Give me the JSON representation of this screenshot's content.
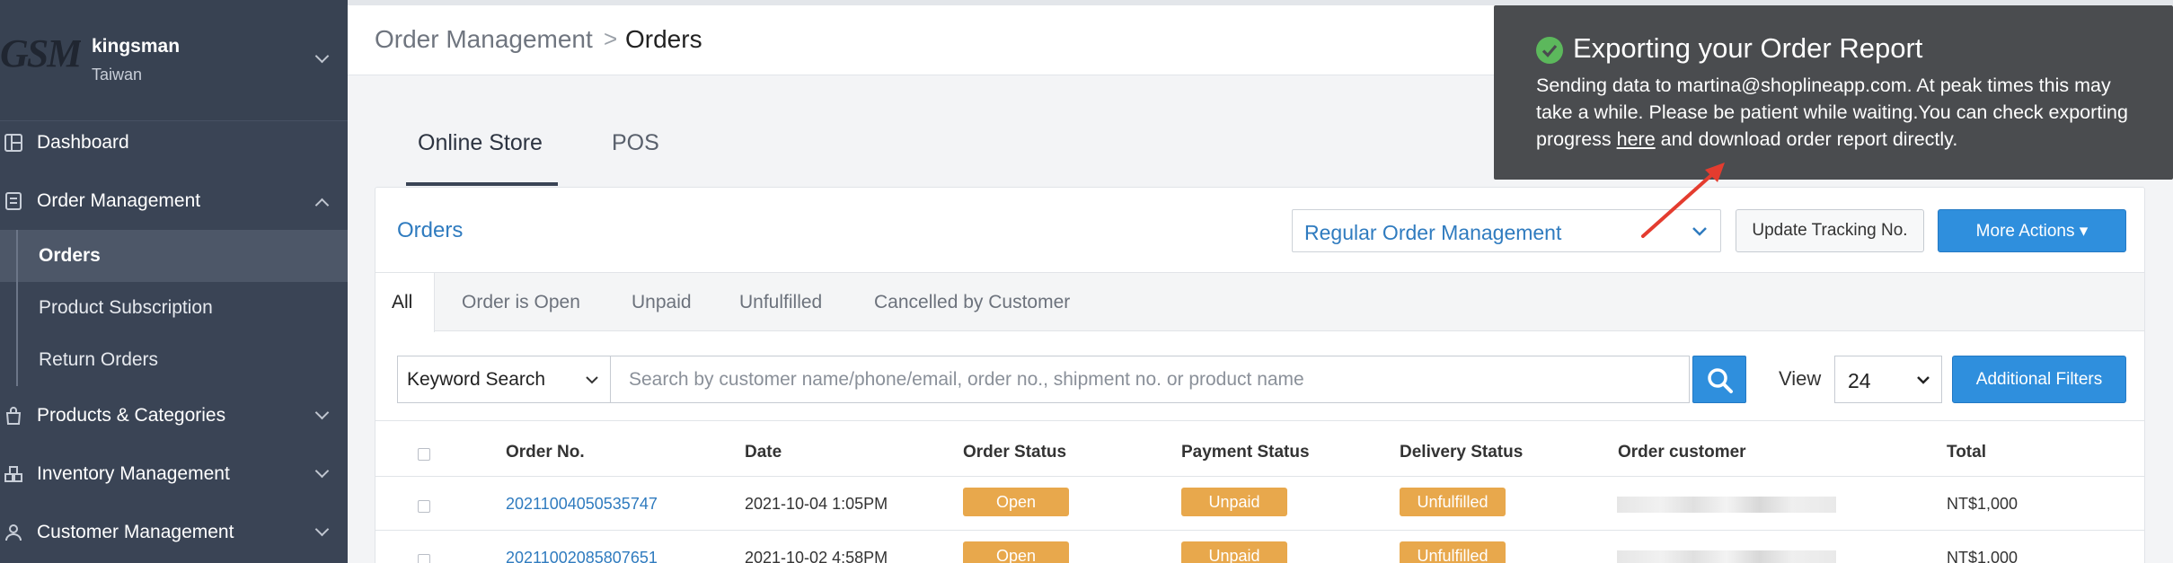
{
  "store": {
    "logo_text": "GSM",
    "name": "kingsman",
    "region": "Taiwan"
  },
  "sidebar": {
    "items": [
      {
        "label": "Dashboard",
        "icon": "dashboard-icon"
      },
      {
        "label": "Order Management",
        "icon": "order-icon",
        "expanded": true
      },
      {
        "label": "Products & Categories",
        "icon": "bag-icon"
      },
      {
        "label": "Inventory Management",
        "icon": "inventory-icon"
      },
      {
        "label": "Customer Management",
        "icon": "user-icon"
      }
    ],
    "sub_items": [
      {
        "label": "Orders",
        "active": true
      },
      {
        "label": "Product Subscription"
      },
      {
        "label": "Return Orders"
      }
    ]
  },
  "breadcrumb": {
    "parent": "Order Management",
    "separator": ">",
    "current": "Orders"
  },
  "channel_tabs": [
    {
      "label": "Online Store",
      "active": true
    },
    {
      "label": "POS"
    }
  ],
  "panel": {
    "title": "Orders",
    "mode_select": "Regular Order Management",
    "update_tracking_label": "Update Tracking No.",
    "more_actions_label": "More Actions ▾"
  },
  "filter_tabs": [
    "All",
    "Order is Open",
    "Unpaid",
    "Unfulfilled",
    "Cancelled by Customer"
  ],
  "search": {
    "keyword_select": "Keyword Search",
    "placeholder": "Search by customer name/phone/email, order no., shipment no. or product name",
    "view_label": "View",
    "view_value": "24",
    "additional_filters_label": "Additional Filters"
  },
  "table": {
    "columns": [
      "Order No.",
      "Date",
      "Order Status",
      "Payment Status",
      "Delivery Status",
      "Order customer",
      "Total"
    ],
    "rows": [
      {
        "order_no": "20211004050535747",
        "date": "2021-10-04 1:05PM",
        "order_status": "Open",
        "payment_status": "Unpaid",
        "delivery_status": "Unfulfilled",
        "total": "NT$1,000"
      },
      {
        "order_no": "20211002085807651",
        "date": "2021-10-02 4:58PM",
        "order_status": "Open",
        "payment_status": "Unpaid",
        "delivery_status": "Unfulfilled",
        "total": "NT$1,000"
      }
    ]
  },
  "toast": {
    "title": "Exporting your Order Report",
    "body_before": "Sending data to martina@shoplineapp.com. At peak times this may take a while. Please be patient while waiting.You can check exporting progress ",
    "link": "here",
    "body_after": " and download order report directly."
  },
  "colors": {
    "sidebar": "#3a4455",
    "accent": "#2f8fdd",
    "badge": "#e8a84c",
    "toast": "#4a4c4f",
    "annotation_arrow": "#e43c2f"
  }
}
